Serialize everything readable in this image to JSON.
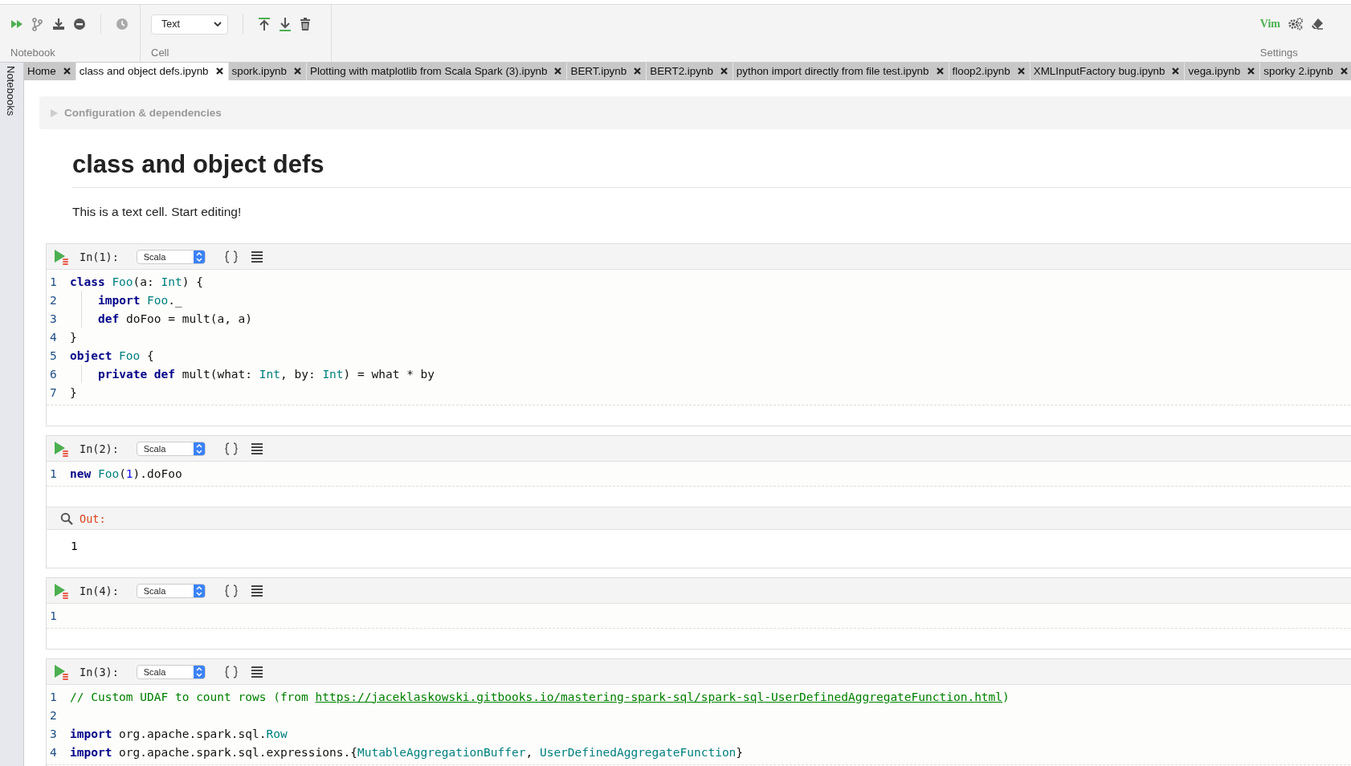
{
  "toolbar": {
    "notebook_label": "Notebook",
    "cell_label": "Cell",
    "cell_type": "Text",
    "vim_label": "Vim",
    "settings_label": "Settings"
  },
  "sidebar": {
    "label": "Notebooks"
  },
  "tabs": [
    {
      "label": "Home",
      "selected": false
    },
    {
      "label": "class and object defs.ipynb",
      "selected": true
    },
    {
      "label": "spork.ipynb",
      "selected": false
    },
    {
      "label": "Plotting with matplotlib from Scala Spark (3).ipynb",
      "selected": false
    },
    {
      "label": "BERT.ipynb",
      "selected": false
    },
    {
      "label": "BERT2.ipynb",
      "selected": false
    },
    {
      "label": "python import directly from file test.ipynb",
      "selected": false
    },
    {
      "label": "floop2.ipynb",
      "selected": false
    },
    {
      "label": "XMLInputFactory bug.ipynb",
      "selected": false
    },
    {
      "label": "vega.ipynb",
      "selected": false
    },
    {
      "label": "sporky 2.ipynb",
      "selected": false
    }
  ],
  "config": {
    "label": "Configuration & dependencies",
    "expanded": false
  },
  "cells": [
    {
      "kind": "text",
      "heading": "class and object defs",
      "body": "This is a text cell. Start editing!"
    },
    {
      "kind": "code",
      "prompt": "In(1):",
      "language": "Scala",
      "lines": [
        {
          "n": "1",
          "indented": false,
          "tokens": [
            {
              "kind": "keyword",
              "t": "class"
            },
            {
              "kind": "type",
              "t": " Foo"
            },
            {
              "kind": "plain",
              "t": "(a: "
            },
            {
              "kind": "type",
              "t": "Int"
            },
            {
              "kind": "plain",
              "t": ") {"
            }
          ]
        },
        {
          "n": "2",
          "indented": true,
          "tokens": [
            {
              "kind": "keyword",
              "t": "import"
            },
            {
              "kind": "type",
              "t": " Foo"
            },
            {
              "kind": "plain",
              "t": "._"
            }
          ]
        },
        {
          "n": "3",
          "indented": true,
          "tokens": [
            {
              "kind": "keyword",
              "t": "def"
            },
            {
              "kind": "plain",
              "t": " doFoo = mult(a, a)"
            }
          ]
        },
        {
          "n": "4",
          "indented": false,
          "tokens": [
            {
              "kind": "plain",
              "t": "}"
            }
          ]
        },
        {
          "n": "5",
          "indented": false,
          "tokens": [
            {
              "kind": "keyword",
              "t": "object"
            },
            {
              "kind": "type",
              "t": " Foo"
            },
            {
              "kind": "plain",
              "t": " {"
            }
          ]
        },
        {
          "n": "6",
          "indented": true,
          "tokens": [
            {
              "kind": "keyword",
              "t": "private def"
            },
            {
              "kind": "plain",
              "t": " mult(what: "
            },
            {
              "kind": "type",
              "t": "Int"
            },
            {
              "kind": "plain",
              "t": ", by: "
            },
            {
              "kind": "type",
              "t": "Int"
            },
            {
              "kind": "plain",
              "t": ") = what * by"
            }
          ]
        },
        {
          "n": "7",
          "indented": false,
          "tokens": [
            {
              "kind": "plain",
              "t": "}"
            }
          ]
        }
      ]
    },
    {
      "kind": "code",
      "prompt": "In(2):",
      "language": "Scala",
      "lines": [
        {
          "n": "1",
          "indented": false,
          "tokens": [
            {
              "kind": "keyword",
              "t": "new"
            },
            {
              "kind": "type",
              "t": " Foo"
            },
            {
              "kind": "plain",
              "t": "("
            },
            {
              "kind": "number",
              "t": "1"
            },
            {
              "kind": "plain",
              "t": ").doFoo"
            }
          ]
        }
      ],
      "output": {
        "label": "Out:",
        "text": "1"
      }
    },
    {
      "kind": "code",
      "prompt": "In(4):",
      "language": "Scala",
      "lines": [
        {
          "n": "1",
          "indented": false
        }
      ]
    },
    {
      "kind": "code",
      "prompt": "In(3):",
      "language": "Scala",
      "lines": [
        {
          "n": "1",
          "indented": false,
          "tokens": [
            {
              "kind": "comment",
              "t": "// Custom UDAF to count rows (from "
            },
            {
              "kind": "link",
              "t": "https://jaceklaskowski.gitbooks.io/mastering-spark-sql/spark-sql-UserDefinedAggregateFunction.html"
            },
            {
              "kind": "comment",
              "t": ")"
            }
          ]
        },
        {
          "n": "2",
          "indented": false
        },
        {
          "n": "3",
          "indented": false,
          "tokens": [
            {
              "kind": "keyword",
              "t": "import"
            },
            {
              "kind": "plain",
              "t": " org.apache.spark.sql."
            },
            {
              "kind": "type",
              "t": "Row"
            }
          ]
        },
        {
          "n": "4",
          "indented": false,
          "tokens": [
            {
              "kind": "keyword",
              "t": "import"
            },
            {
              "kind": "plain",
              "t": " org.apache.spark.sql.expressions.{"
            },
            {
              "kind": "type",
              "t": "MutableAggregationBuffer"
            },
            {
              "kind": "plain",
              "t": ", "
            },
            {
              "kind": "type",
              "t": "UserDefinedAggregateFunction"
            },
            {
              "kind": "plain",
              "t": "}"
            }
          ]
        }
      ]
    }
  ]
}
